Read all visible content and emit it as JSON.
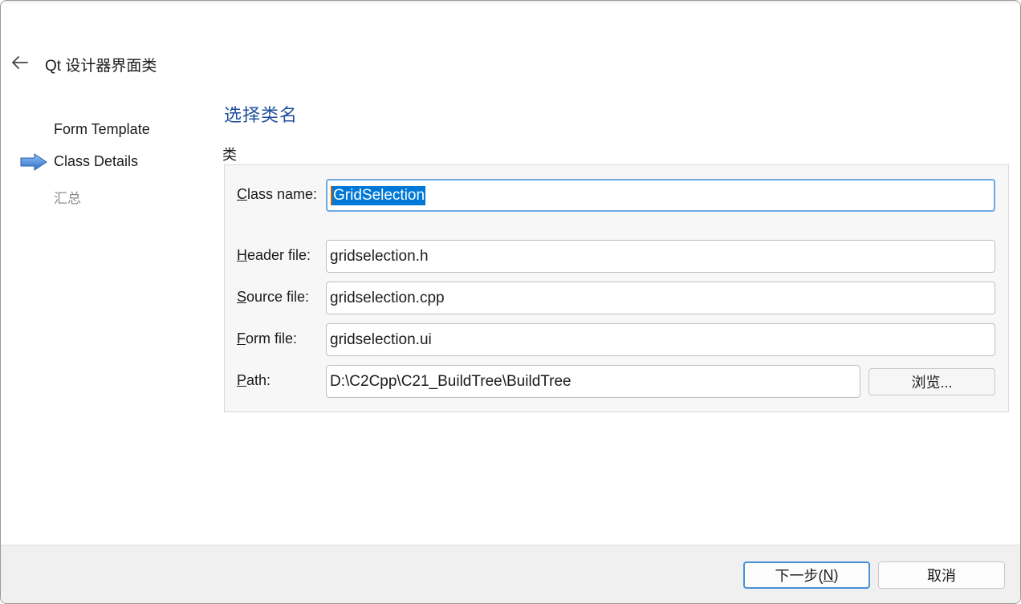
{
  "dialog": {
    "title": "Qt 设计器界面类"
  },
  "steps": [
    {
      "label": "Form Template",
      "state": "done"
    },
    {
      "label": "Class Details",
      "state": "current"
    },
    {
      "label": "汇总",
      "state": "pending"
    }
  ],
  "page": {
    "heading": "选择类名",
    "group_label": "类"
  },
  "fields": {
    "class_name": {
      "label_mnemonic": "C",
      "label_rest": "lass name:",
      "value": "GridSelection"
    },
    "header_file": {
      "label_mnemonic": "H",
      "label_rest": "eader file:",
      "value": "gridselection.h"
    },
    "source_file": {
      "label_mnemonic": "S",
      "label_rest": "ource file:",
      "value": "gridselection.cpp"
    },
    "form_file": {
      "label_mnemonic": "F",
      "label_rest": "orm file:",
      "value": "gridselection.ui"
    },
    "path": {
      "label_mnemonic": "P",
      "label_rest": "ath:",
      "value": "D:\\C2Cpp\\C21_BuildTree\\BuildTree"
    }
  },
  "buttons": {
    "browse": "浏览...",
    "next_prefix": "下一步(",
    "next_mnemonic": "N",
    "next_suffix": ")",
    "cancel": "取消"
  },
  "colors": {
    "heading": "#1e4f9c",
    "selection": "#0078d7",
    "focus_border": "#6aa9e4",
    "step_arrow": "#3d7fd6"
  },
  "icons": {
    "back": "arrow-left-icon",
    "current_step": "step-arrow-icon"
  }
}
